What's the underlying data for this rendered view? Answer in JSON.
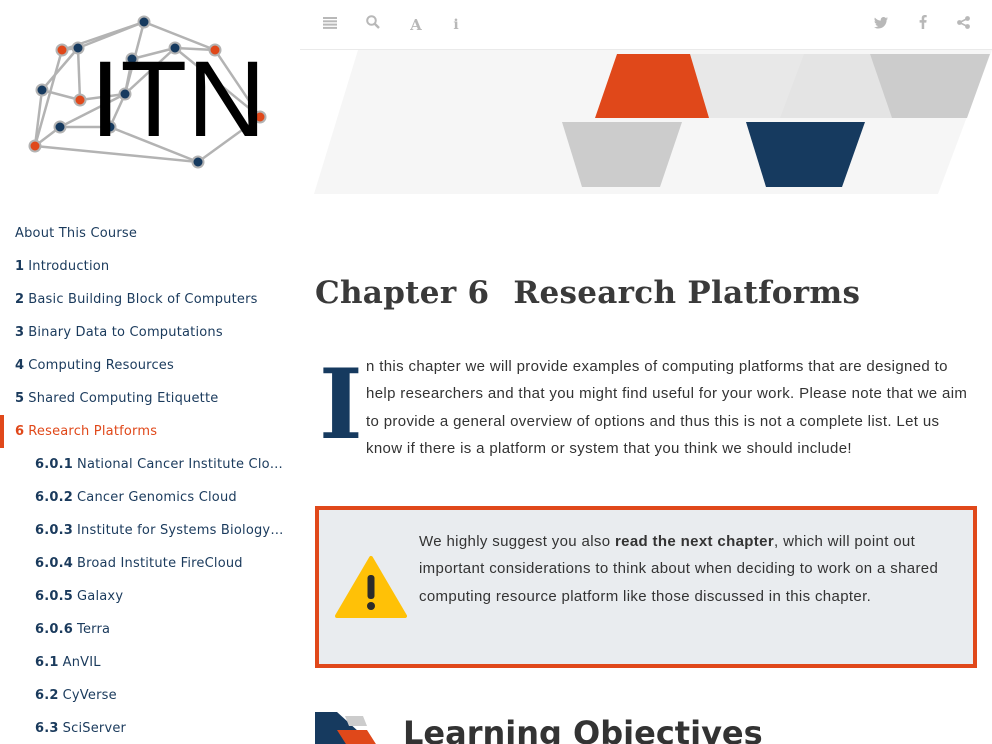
{
  "logo": {
    "text": "ITN"
  },
  "toolbar": {
    "left_icons": [
      "sidebar-toggle-icon",
      "search-icon",
      "font-settings-icon",
      "info-icon"
    ],
    "right_icons": [
      "twitter-icon",
      "facebook-icon",
      "share-icon"
    ]
  },
  "toc": [
    {
      "num": "",
      "label": "About This Course",
      "level": 0
    },
    {
      "num": "1",
      "label": "Introduction",
      "level": 0
    },
    {
      "num": "2",
      "label": "Basic Building Block of Computers",
      "level": 0
    },
    {
      "num": "3",
      "label": "Binary Data to Computations",
      "level": 0
    },
    {
      "num": "4",
      "label": "Computing Resources",
      "level": 0
    },
    {
      "num": "5",
      "label": "Shared Computing Etiquette",
      "level": 0
    },
    {
      "num": "6",
      "label": "Research Platforms",
      "level": 0,
      "active": true
    },
    {
      "num": "6.0.1",
      "label": "National Cancer Institute Cloud Resources",
      "level": 1
    },
    {
      "num": "6.0.2",
      "label": "Cancer Genomics Cloud",
      "level": 1
    },
    {
      "num": "6.0.3",
      "label": "Institute for Systems Biology (ISB)",
      "level": 1
    },
    {
      "num": "6.0.4",
      "label": "Broad Institute FireCloud",
      "level": 1
    },
    {
      "num": "6.0.5",
      "label": "Galaxy",
      "level": 1
    },
    {
      "num": "6.0.6",
      "label": "Terra",
      "level": 1
    },
    {
      "num": "6.1",
      "label": "AnVIL",
      "level": 1
    },
    {
      "num": "6.2",
      "label": "CyVerse",
      "level": 1
    },
    {
      "num": "6.3",
      "label": "SciServer",
      "level": 1
    }
  ],
  "chapter": {
    "prefix": "Chapter 6",
    "title": "Research Platforms",
    "dropcap_letter": "I",
    "intro_rest": "n this chapter we will provide examples of computing platforms that are designed to help researchers and that you might find useful for your work. Please note that we aim to provide a general overview of options and thus this is not a complete list. Let us know if there is a platform or system that you think we should include!"
  },
  "callout": {
    "before": "We highly suggest you also ",
    "bold": "read the next chapter",
    "after": ", which will point out important considerations to think about when deciding to work on a shared computing resource platform like those discussed in this chapter."
  },
  "section": {
    "title": "Learning Objectives"
  },
  "colors": {
    "accent_orange": "#e0481a",
    "navy": "#163a5f",
    "light_gray": "#cccccc",
    "warning_yellow": "#ffc107"
  }
}
